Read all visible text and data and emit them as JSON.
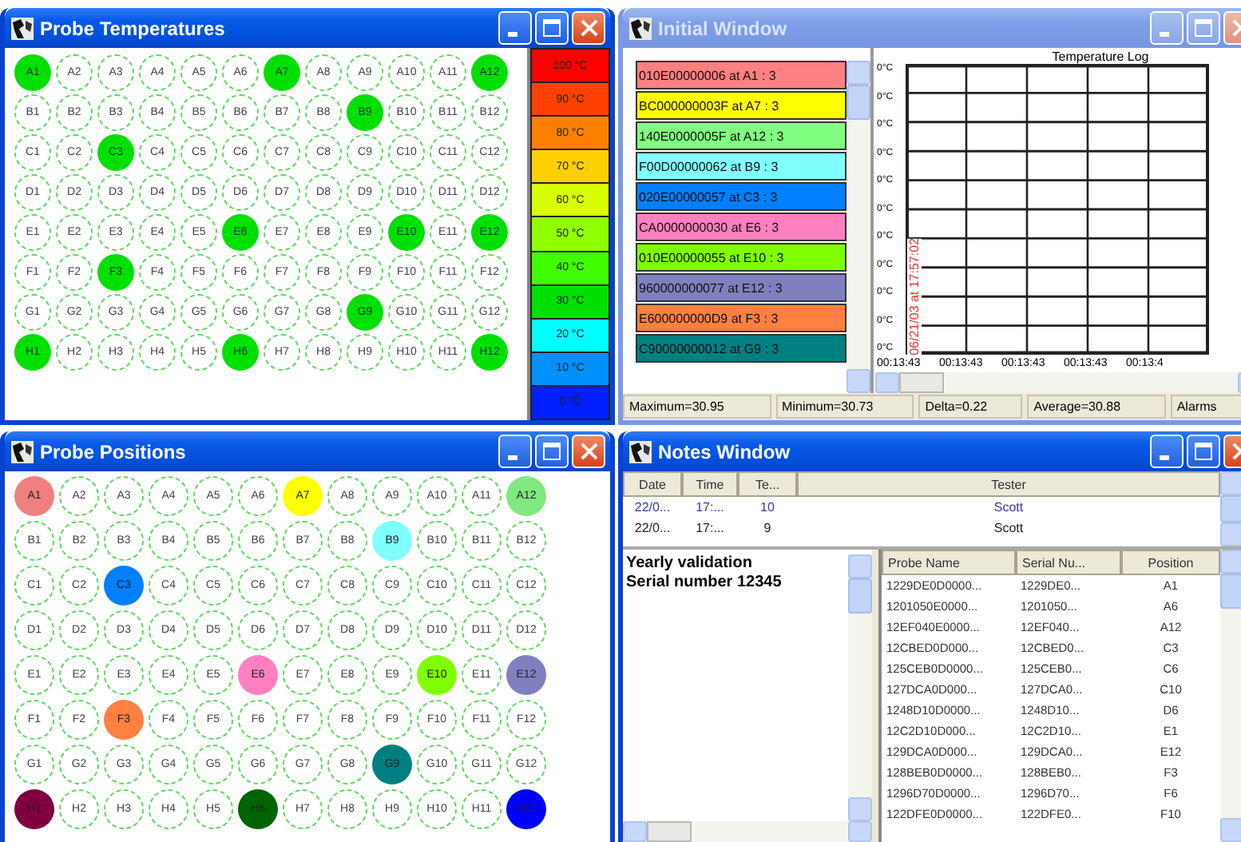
{
  "windows": {
    "temperatures": {
      "title": "Probe Temperatures",
      "active": true,
      "rows": [
        {
          "wells": [
            {
              "label": "A1",
              "lit": true
            },
            {
              "label": "A2",
              "lit": false
            },
            {
              "label": "A3",
              "lit": false
            },
            {
              "label": "A4",
              "lit": false
            },
            {
              "label": "A5",
              "lit": false
            },
            {
              "label": "A6",
              "lit": false
            },
            {
              "label": "A7",
              "lit": true
            },
            {
              "label": "A8",
              "lit": false
            },
            {
              "label": "A9",
              "lit": false
            },
            {
              "label": "A10",
              "lit": false
            },
            {
              "label": "A11",
              "lit": false
            },
            {
              "label": "A12",
              "lit": true
            }
          ]
        },
        {
          "wells": [
            {
              "label": "B1",
              "lit": false
            },
            {
              "label": "B2",
              "lit": false
            },
            {
              "label": "B3",
              "lit": false
            },
            {
              "label": "B4",
              "lit": false
            },
            {
              "label": "B5",
              "lit": false
            },
            {
              "label": "B6",
              "lit": false
            },
            {
              "label": "B7",
              "lit": false
            },
            {
              "label": "B8",
              "lit": false
            },
            {
              "label": "B9",
              "lit": true
            },
            {
              "label": "B10",
              "lit": false
            },
            {
              "label": "B11",
              "lit": false
            },
            {
              "label": "B12",
              "lit": false
            }
          ]
        },
        {
          "wells": [
            {
              "label": "C1",
              "lit": false
            },
            {
              "label": "C2",
              "lit": false
            },
            {
              "label": "C3",
              "lit": true
            },
            {
              "label": "C4",
              "lit": false
            },
            {
              "label": "C5",
              "lit": false
            },
            {
              "label": "C6",
              "lit": false
            },
            {
              "label": "C7",
              "lit": false
            },
            {
              "label": "C8",
              "lit": false
            },
            {
              "label": "C9",
              "lit": false
            },
            {
              "label": "C10",
              "lit": false
            },
            {
              "label": "C11",
              "lit": false
            },
            {
              "label": "C12",
              "lit": false
            }
          ]
        },
        {
          "wells": [
            {
              "label": "D1",
              "lit": false
            },
            {
              "label": "D2",
              "lit": false
            },
            {
              "label": "D3",
              "lit": false
            },
            {
              "label": "D4",
              "lit": false
            },
            {
              "label": "D5",
              "lit": false
            },
            {
              "label": "D6",
              "lit": false
            },
            {
              "label": "D7",
              "lit": false
            },
            {
              "label": "D8",
              "lit": false
            },
            {
              "label": "D9",
              "lit": false
            },
            {
              "label": "D10",
              "lit": false
            },
            {
              "label": "D11",
              "lit": false
            },
            {
              "label": "D12",
              "lit": false
            }
          ]
        },
        {
          "wells": [
            {
              "label": "E1",
              "lit": false
            },
            {
              "label": "E2",
              "lit": false
            },
            {
              "label": "E3",
              "lit": false
            },
            {
              "label": "E4",
              "lit": false
            },
            {
              "label": "E5",
              "lit": false
            },
            {
              "label": "E6",
              "lit": true
            },
            {
              "label": "E7",
              "lit": false
            },
            {
              "label": "E8",
              "lit": false
            },
            {
              "label": "E9",
              "lit": false
            },
            {
              "label": "E10",
              "lit": true
            },
            {
              "label": "E11",
              "lit": false
            },
            {
              "label": "E12",
              "lit": true
            }
          ]
        },
        {
          "wells": [
            {
              "label": "F1",
              "lit": false
            },
            {
              "label": "F2",
              "lit": false
            },
            {
              "label": "F3",
              "lit": true
            },
            {
              "label": "F4",
              "lit": false
            },
            {
              "label": "F5",
              "lit": false
            },
            {
              "label": "F6",
              "lit": false
            },
            {
              "label": "F7",
              "lit": false
            },
            {
              "label": "F8",
              "lit": false
            },
            {
              "label": "F9",
              "lit": false
            },
            {
              "label": "F10",
              "lit": false
            },
            {
              "label": "F11",
              "lit": false
            },
            {
              "label": "F12",
              "lit": false
            }
          ]
        },
        {
          "wells": [
            {
              "label": "G1",
              "lit": false
            },
            {
              "label": "G2",
              "lit": false
            },
            {
              "label": "G3",
              "lit": false
            },
            {
              "label": "G4",
              "lit": false
            },
            {
              "label": "G5",
              "lit": false
            },
            {
              "label": "G6",
              "lit": false
            },
            {
              "label": "G7",
              "lit": false
            },
            {
              "label": "G8",
              "lit": false
            },
            {
              "label": "G9",
              "lit": true
            },
            {
              "label": "G10",
              "lit": false
            },
            {
              "label": "G11",
              "lit": false
            },
            {
              "label": "G12",
              "lit": false
            }
          ]
        },
        {
          "wells": [
            {
              "label": "H1",
              "lit": true
            },
            {
              "label": "H2",
              "lit": false
            },
            {
              "label": "H3",
              "lit": false
            },
            {
              "label": "H4",
              "lit": false
            },
            {
              "label": "H5",
              "lit": false
            },
            {
              "label": "H6",
              "lit": true
            },
            {
              "label": "H7",
              "lit": false
            },
            {
              "label": "H8",
              "lit": false
            },
            {
              "label": "H9",
              "lit": false
            },
            {
              "label": "H10",
              "lit": false
            },
            {
              "label": "H11",
              "lit": false
            },
            {
              "label": "H12",
              "lit": true
            }
          ]
        }
      ],
      "legend": [
        {
          "label": "100 °C",
          "color": "#ff0000"
        },
        {
          "label": "90 °C",
          "color": "#ff4000"
        },
        {
          "label": "80 °C",
          "color": "#ff8000"
        },
        {
          "label": "70 °C",
          "color": "#ffd000"
        },
        {
          "label": "60 °C",
          "color": "#d8ff00"
        },
        {
          "label": "50 °C",
          "color": "#90ff00"
        },
        {
          "label": "40 °C",
          "color": "#40ff00"
        },
        {
          "label": "30 °C",
          "color": "#00e000"
        },
        {
          "label": "20 °C",
          "color": "#00ffff"
        },
        {
          "label": "10 °C",
          "color": "#0090ff"
        },
        {
          "label": "0 °C",
          "color": "#0020ff"
        }
      ]
    },
    "initial": {
      "title": "Initial Window",
      "active": false,
      "probes": [
        {
          "text": "010E00000006 at A1 : 3",
          "color": "#ff8080"
        },
        {
          "text": "BC000000003F at A7 : 3",
          "color": "#ffff00"
        },
        {
          "text": "140E0000005F at A12 : 3",
          "color": "#80ff80"
        },
        {
          "text": "F00D00000062 at B9 : 3",
          "color": "#80ffff"
        },
        {
          "text": "020E00000057 at C3 : 3",
          "color": "#0080ff"
        },
        {
          "text": "CA0000000030 at E6 : 3",
          "color": "#ff80c0"
        },
        {
          "text": "010E00000055 at E10 : 3",
          "color": "#80ff00"
        },
        {
          "text": "960000000077 at E12 : 3",
          "color": "#8080c0"
        },
        {
          "text": "E600000000D9 at F3 : 3",
          "color": "#ff8040"
        },
        {
          "text": "C90000000012 at G9 : 3",
          "color": "#008080"
        }
      ],
      "chart": {
        "title": "Temperature Log",
        "stamp": "06/21/03 at 17:57:02",
        "yticks": [
          "0°C",
          "0°C",
          "0°C",
          "0°C",
          "0°C",
          "0°C",
          "0°C",
          "0°C",
          "0°C",
          "0°C",
          "0°C"
        ],
        "xticks": [
          "00:13:43",
          "00:13:43",
          "00:13:43",
          "00:13:43",
          "00:13:4"
        ]
      },
      "status_bar": [
        "Maximum=30.95",
        "Minimum=30.73",
        "Delta=0.22",
        "Average=30.88",
        "Alarms"
      ]
    },
    "positions": {
      "title": "Probe Positions",
      "active": true,
      "rows": [
        {
          "wells": [
            {
              "label": "A1",
              "color": "#f08080"
            },
            {
              "label": "A2"
            },
            {
              "label": "A3"
            },
            {
              "label": "A4"
            },
            {
              "label": "A5"
            },
            {
              "label": "A6"
            },
            {
              "label": "A7",
              "color": "#ffff00"
            },
            {
              "label": "A8"
            },
            {
              "label": "A9"
            },
            {
              "label": "A10"
            },
            {
              "label": "A11"
            },
            {
              "label": "A12",
              "color": "#80e880"
            }
          ]
        },
        {
          "wells": [
            {
              "label": "B1"
            },
            {
              "label": "B2"
            },
            {
              "label": "B3"
            },
            {
              "label": "B4"
            },
            {
              "label": "B5"
            },
            {
              "label": "B6"
            },
            {
              "label": "B7"
            },
            {
              "label": "B8"
            },
            {
              "label": "B9",
              "color": "#80ffff"
            },
            {
              "label": "B10"
            },
            {
              "label": "B11"
            },
            {
              "label": "B12"
            }
          ]
        },
        {
          "wells": [
            {
              "label": "C1"
            },
            {
              "label": "C2"
            },
            {
              "label": "C3",
              "color": "#0080ff"
            },
            {
              "label": "C4"
            },
            {
              "label": "C5"
            },
            {
              "label": "C6"
            },
            {
              "label": "C7"
            },
            {
              "label": "C8"
            },
            {
              "label": "C9"
            },
            {
              "label": "C10"
            },
            {
              "label": "C11"
            },
            {
              "label": "C12"
            }
          ]
        },
        {
          "wells": [
            {
              "label": "D1"
            },
            {
              "label": "D2"
            },
            {
              "label": "D3"
            },
            {
              "label": "D4"
            },
            {
              "label": "D5"
            },
            {
              "label": "D6"
            },
            {
              "label": "D7"
            },
            {
              "label": "D8"
            },
            {
              "label": "D9"
            },
            {
              "label": "D10"
            },
            {
              "label": "D11"
            },
            {
              "label": "D12"
            }
          ]
        },
        {
          "wells": [
            {
              "label": "E1"
            },
            {
              "label": "E2"
            },
            {
              "label": "E3"
            },
            {
              "label": "E4"
            },
            {
              "label": "E5"
            },
            {
              "label": "E6",
              "color": "#ff80c0"
            },
            {
              "label": "E7"
            },
            {
              "label": "E8"
            },
            {
              "label": "E9"
            },
            {
              "label": "E10",
              "color": "#80ff00"
            },
            {
              "label": "E11"
            },
            {
              "label": "E12",
              "color": "#8080c0"
            }
          ]
        },
        {
          "wells": [
            {
              "label": "F1"
            },
            {
              "label": "F2"
            },
            {
              "label": "F3",
              "color": "#ff8040"
            },
            {
              "label": "F4"
            },
            {
              "label": "F5"
            },
            {
              "label": "F6"
            },
            {
              "label": "F7"
            },
            {
              "label": "F8"
            },
            {
              "label": "F9"
            },
            {
              "label": "F10"
            },
            {
              "label": "F11"
            },
            {
              "label": "F12"
            }
          ]
        },
        {
          "wells": [
            {
              "label": "G1"
            },
            {
              "label": "G2"
            },
            {
              "label": "G3"
            },
            {
              "label": "G4"
            },
            {
              "label": "G5"
            },
            {
              "label": "G6"
            },
            {
              "label": "G7"
            },
            {
              "label": "G8"
            },
            {
              "label": "G9",
              "color": "#008080"
            },
            {
              "label": "G10"
            },
            {
              "label": "G11"
            },
            {
              "label": "G12"
            }
          ]
        },
        {
          "wells": [
            {
              "label": "H1",
              "color": "#800040"
            },
            {
              "label": "H2"
            },
            {
              "label": "H3"
            },
            {
              "label": "H4"
            },
            {
              "label": "H5"
            },
            {
              "label": "H6",
              "color": "#006400"
            },
            {
              "label": "H7"
            },
            {
              "label": "H8"
            },
            {
              "label": "H9"
            },
            {
              "label": "H10"
            },
            {
              "label": "H11"
            },
            {
              "label": "H12",
              "color": "#0000ff"
            }
          ]
        }
      ]
    },
    "notes": {
      "title": "Notes Window",
      "active": true,
      "sessions": {
        "columns": [
          "Date",
          "Time",
          "Te...",
          "Tester"
        ],
        "rows": [
          {
            "cells": [
              "22/0...",
              "17:...",
              "10",
              "Scott"
            ],
            "selected": true
          },
          {
            "cells": [
              "22/0...",
              "17:...",
              "9",
              "Scott"
            ],
            "selected": false
          }
        ]
      },
      "note_lines": [
        "Yearly validation",
        "Serial number 12345"
      ],
      "probes": {
        "columns": [
          "Probe Name",
          "Serial Nu...",
          "Position"
        ],
        "rows": [
          [
            "1229DE0D0000...",
            "1229DE0...",
            "A1"
          ],
          [
            "1201050E0000...",
            "1201050...",
            "A6"
          ],
          [
            "12EF040E0000...",
            "12EF040...",
            "A12"
          ],
          [
            "12CBED0D000...",
            "12CBED0...",
            "C3"
          ],
          [
            "125CEB0D0000...",
            "125CEB0...",
            "C6"
          ],
          [
            "127DCA0D000...",
            "127DCA0...",
            "C10"
          ],
          [
            "1248D10D0000...",
            "1248D10...",
            "D6"
          ],
          [
            "12C2D10D000...",
            "12C2D10...",
            "E1"
          ],
          [
            "129DCA0D000...",
            "129DCA0...",
            "E12"
          ],
          [
            "128BEB0D0000...",
            "128BEB0...",
            "F3"
          ],
          [
            "1296D70D0000...",
            "1296D70...",
            "F6"
          ],
          [
            "122DFE0D0000...",
            "122DFE0...",
            "F10"
          ]
        ]
      }
    }
  }
}
